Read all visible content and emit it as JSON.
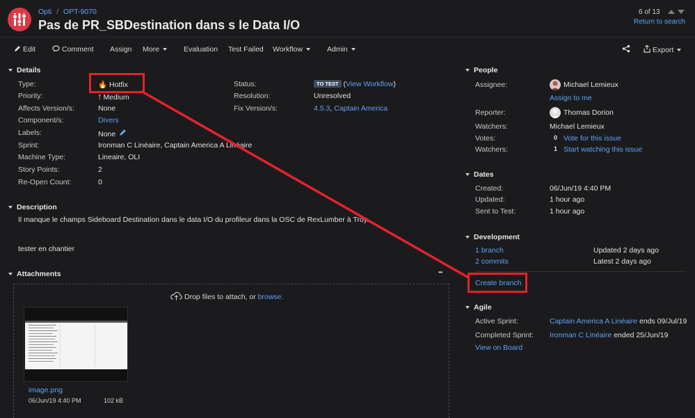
{
  "header": {
    "project": "Opti",
    "separator": "/",
    "issue_key": "OPT-9070",
    "title": "Pas de PR_SBDestination dans s le Data I/O",
    "pager": "6 of 13",
    "return_search": "Return to search"
  },
  "toolbar": {
    "edit": "Edit",
    "comment": "Comment",
    "assign": "Assign",
    "more": "More",
    "evaluation": "Evaluation",
    "test_failed": "Test Failed",
    "workflow": "Workflow",
    "admin": "Admin",
    "export": "Export"
  },
  "details": {
    "title": "Details",
    "type_label": "Type:",
    "type_value": "Hotfix",
    "priority_label": "Priority:",
    "priority_value": "Medium",
    "affects_label": "Affects Version/s:",
    "affects_value": "None",
    "component_label": "Component/s:",
    "component_value": "Divers",
    "labels_label": "Labels:",
    "labels_value": "None",
    "sprint_label": "Sprint:",
    "sprint_value": "Ironman C Linéaire, Captain America A Linéaire",
    "machine_label": "Machine Type:",
    "machine_value": "Lineaire, OLI",
    "points_label": "Story Points:",
    "points_value": "2",
    "reopen_label": "Re-Open Count:",
    "reopen_value": "0",
    "status_label": "Status:",
    "status_badge": "TO TEST",
    "status_open": "(",
    "status_link": "View Workflow",
    "status_close": ")",
    "resolution_label": "Resolution:",
    "resolution_value": "Unresolved",
    "fix_label": "Fix Version/s:",
    "fix_v1": "4.5.3",
    "fix_comma": ",",
    "fix_v2": "Captain America"
  },
  "description": {
    "title": "Description",
    "line1": "Il manque le champs Sideboard Destination dans le data I/O du profileur dans la OSC de RexLumber à Troy.",
    "line2": "tester en chantier"
  },
  "attachments": {
    "title": "Attachments",
    "more": "•••",
    "drop_text": "Drop files to attach, or",
    "browse": "browse.",
    "file_name": "image.png",
    "file_date": "06/Jun/19 4:40 PM",
    "file_size": "102 kB"
  },
  "people": {
    "title": "People",
    "assignee_label": "Assignee:",
    "assignee_value": "Michael Lemieux",
    "assign_me": "Assign to me",
    "reporter_label": "Reporter:",
    "reporter_value": "Thomas Dorion",
    "watchers1_label": "Watchers:",
    "watchers1_value": "Michael Lemieux",
    "votes_label": "Votes:",
    "votes_count": "0",
    "votes_link": "Vote for this issue",
    "watchers2_label": "Watchers:",
    "watchers2_count": "1",
    "watchers2_link": "Start watching this issue"
  },
  "dates": {
    "title": "Dates",
    "created_label": "Created:",
    "created_value": "06/Jun/19 4:40 PM",
    "updated_label": "Updated:",
    "updated_value": "1 hour ago",
    "sent_label": "Sent to Test:",
    "sent_value": "1 hour ago"
  },
  "development": {
    "title": "Development",
    "branch_link": "1 branch",
    "branch_info": "Updated 2 days ago",
    "commits_link": "2 commits",
    "commits_info": "Latest 2 days ago",
    "create_branch": "Create branch"
  },
  "agile": {
    "title": "Agile",
    "active_label": "Active Sprint:",
    "active_link": "Captain America A Linéaire",
    "active_rest": "ends 09/Jul/19",
    "completed_label": "Completed Sprint:",
    "completed_link": "Ironman C Linéaire",
    "completed_rest": "ended 25/Jun/19",
    "board_link": "View on Board"
  },
  "colors": {
    "background": "#1b1b1d",
    "link": "#5ea3f4",
    "annotation_red": "#e5222b",
    "project_avatar": "#d93a47"
  }
}
